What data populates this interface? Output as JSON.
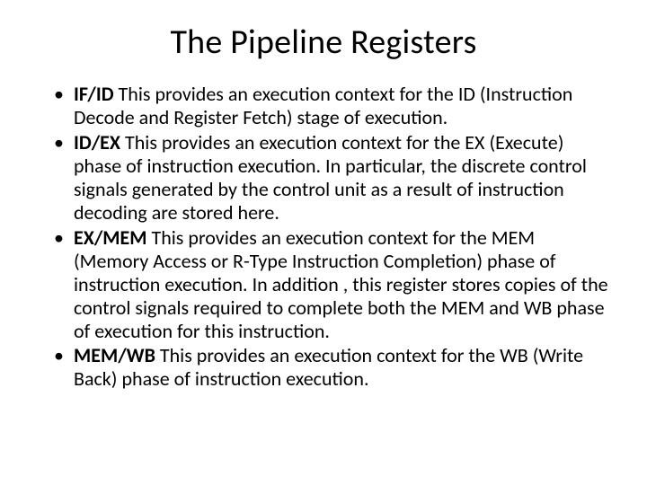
{
  "title": "The Pipeline Registers",
  "bullets": [
    {
      "term": "IF/ID",
      "desc": "   This provides an execution context for the ID (Instruction Decode and Register Fetch) stage of execution."
    },
    {
      "term": "ID/EX",
      "desc": "   This provides an execution context for the EX (Execute) phase of instruction execution.  In particular, the discrete control signals generated by the control unit as a result of instruction decoding are stored here."
    },
    {
      "term": "EX/MEM",
      "desc": "   This provides an execution context for the MEM (Memory Access or R-Type Instruction Completion) phase of instruction execution.  In addition , this register stores copies of the control signals required to complete both the MEM and WB phase of execution for this instruction."
    },
    {
      "term": "MEM/WB",
      "desc": "   This provides an execution context for the WB (Write Back) phase of instruction execution."
    }
  ]
}
